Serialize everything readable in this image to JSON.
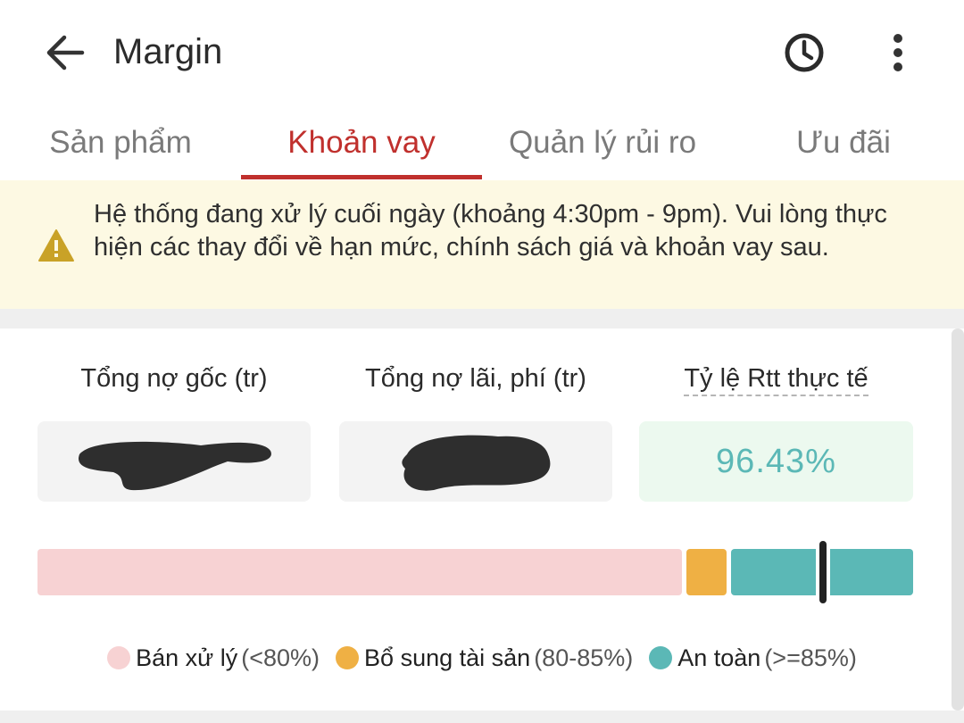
{
  "header": {
    "title": "Margin",
    "back_icon": "arrow-left-icon",
    "history_icon": "clock-icon",
    "menu_icon": "more-vertical-icon"
  },
  "tabs": [
    {
      "label": "Sản phẩm",
      "active": false
    },
    {
      "label": "Khoản vay",
      "active": true
    },
    {
      "label": "Quản lý rủi ro",
      "active": false
    },
    {
      "label": "Ưu đãi",
      "active": false
    }
  ],
  "banner": {
    "icon": "warning-icon",
    "text": "Hệ thống đang xử lý cuối ngày (khoảng 4:30pm - 9pm). Vui lòng thực hiện các thay đổi về hạn mức, chính sách giá và khoản vay sau."
  },
  "stats": {
    "principal_label": "Tổng nợ gốc (tr)",
    "interest_label": "Tổng nợ lãi, phí (tr)",
    "rtt_label": "Tỷ lệ Rtt thực tế",
    "rtt_value": "96.43%"
  },
  "risk_bar": {
    "current_ratio_percent": 96.43
  },
  "legend": [
    {
      "name": "Bán xử lý",
      "range": "(<80%)",
      "color": "#f7d2d3"
    },
    {
      "name": "Bổ sung tài sản",
      "range": "(80-85%)",
      "color": "#efb044"
    },
    {
      "name": "An toàn",
      "range": "(>=85%)",
      "color": "#5bb8b6"
    }
  ],
  "colors": {
    "accent": "#c0302d",
    "banner_bg": "#fdf9e3",
    "warning": "#c9a227",
    "safe_bg": "#ecf9ef"
  }
}
